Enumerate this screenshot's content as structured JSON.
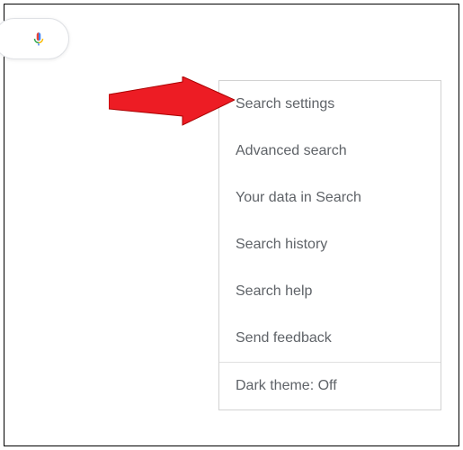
{
  "icons": {
    "mic": "microphone-icon"
  },
  "menu": {
    "items": [
      {
        "label": "Search settings"
      },
      {
        "label": "Advanced search"
      },
      {
        "label": "Your data in Search"
      },
      {
        "label": "Search history"
      },
      {
        "label": "Search help"
      },
      {
        "label": "Send feedback"
      }
    ],
    "dark_theme_label": "Dark theme: Off"
  },
  "colors": {
    "arrow": "#ed1c24",
    "menu_text": "#5f6368",
    "border": "#d2d2d2"
  }
}
